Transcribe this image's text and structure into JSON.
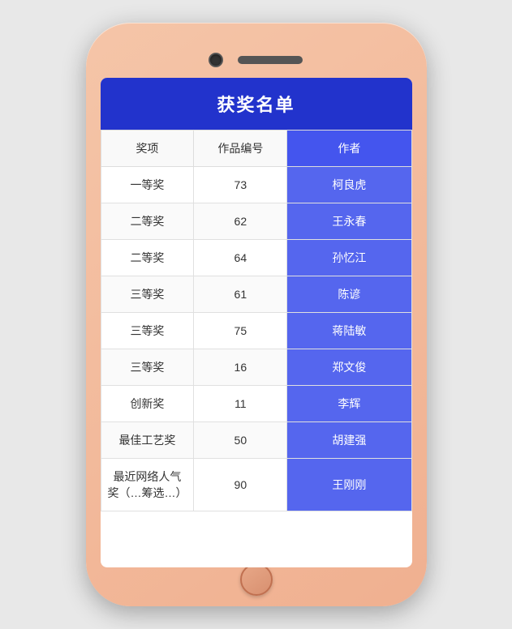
{
  "phone": {
    "title": "获奖名单"
  },
  "table": {
    "headers": {
      "prize": "奖项",
      "work_id": "作品编号",
      "author": "作者"
    },
    "rows": [
      {
        "prize": "一等奖",
        "work_id": "73",
        "author": "柯良虎"
      },
      {
        "prize": "二等奖",
        "work_id": "62",
        "author": "王永春"
      },
      {
        "prize": "二等奖",
        "work_id": "64",
        "author": "孙忆江"
      },
      {
        "prize": "三等奖",
        "work_id": "61",
        "author": "陈谚"
      },
      {
        "prize": "三等奖",
        "work_id": "75",
        "author": "蒋陆敏"
      },
      {
        "prize": "三等奖",
        "work_id": "16",
        "author": "郑文俊"
      },
      {
        "prize": "创新奖",
        "work_id": "11",
        "author": "李辉"
      },
      {
        "prize": "最佳工艺奖",
        "work_id": "50",
        "author": "胡建强"
      },
      {
        "prize": "最近网络人气奖（…筹选…）",
        "work_id": "90",
        "author": "王刚刚"
      }
    ]
  }
}
